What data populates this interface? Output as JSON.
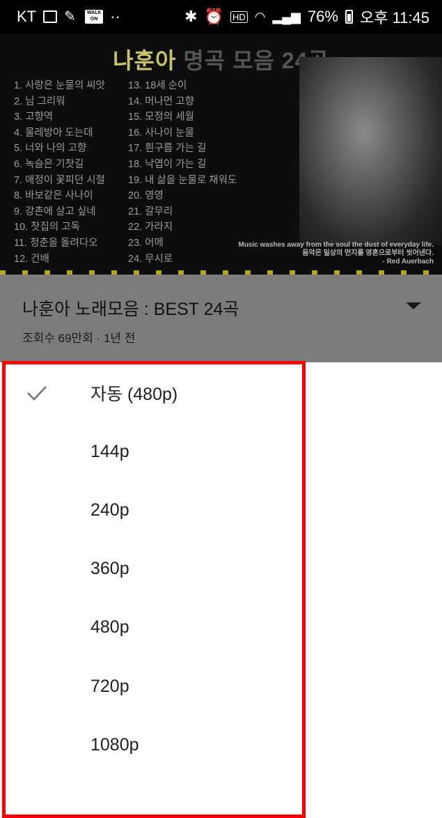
{
  "status_bar": {
    "carrier": "KT",
    "walk_badge": "WALK ON",
    "dots": "··",
    "battery": "76%",
    "time": "오후 11:45"
  },
  "video": {
    "thumbnail_title_highlight": "나훈아",
    "thumbnail_title_rest": " 명곡 모음 24곡",
    "songs_col1": [
      "1. 사랑은 눈물의 씨앗",
      "2. 님 그리워",
      "3. 고향역",
      "4. 물레방아 도는데",
      "5. 너와 나의 고향",
      "6. 녹슬은 기찻길",
      "7. 애정이 꽃피던 시절",
      "8. 바보같은 사나이",
      "9. 강촌에 살고 싶네",
      "10. 찻집의 고독",
      "11. 청춘을 돌려다오",
      "12. 건배"
    ],
    "songs_col2": [
      "13. 18세 순이",
      "14. 머나먼 고향",
      "15. 모정의 세월",
      "16. 사나이 눈물",
      "17. 흰구름 가는 길",
      "18. 낙엽이 가는 길",
      "19. 내 삶을 눈물로 채워도",
      "20. 영영",
      "21. 갈무리",
      "22. 가라지",
      "23. 어메",
      "24. 무시로"
    ],
    "quote_en": "Music washes away from the soul the dust of everyday life.",
    "quote_ko": "음악은 일상의 먼지를 영혼으로부터 씻어낸다.",
    "quote_author": "- Red Auerbach",
    "title": "나훈아 노래모음 : BEST 24곡",
    "meta": "조회수 69만회 · 1년 전"
  },
  "quality_menu": {
    "selected_index": 0,
    "options": [
      "자동 (480p)",
      "144p",
      "240p",
      "360p",
      "480p",
      "720p",
      "1080p"
    ]
  },
  "colors": {
    "highlight_border": "#ff0000",
    "dim_overlay": "#7c7c7c"
  }
}
